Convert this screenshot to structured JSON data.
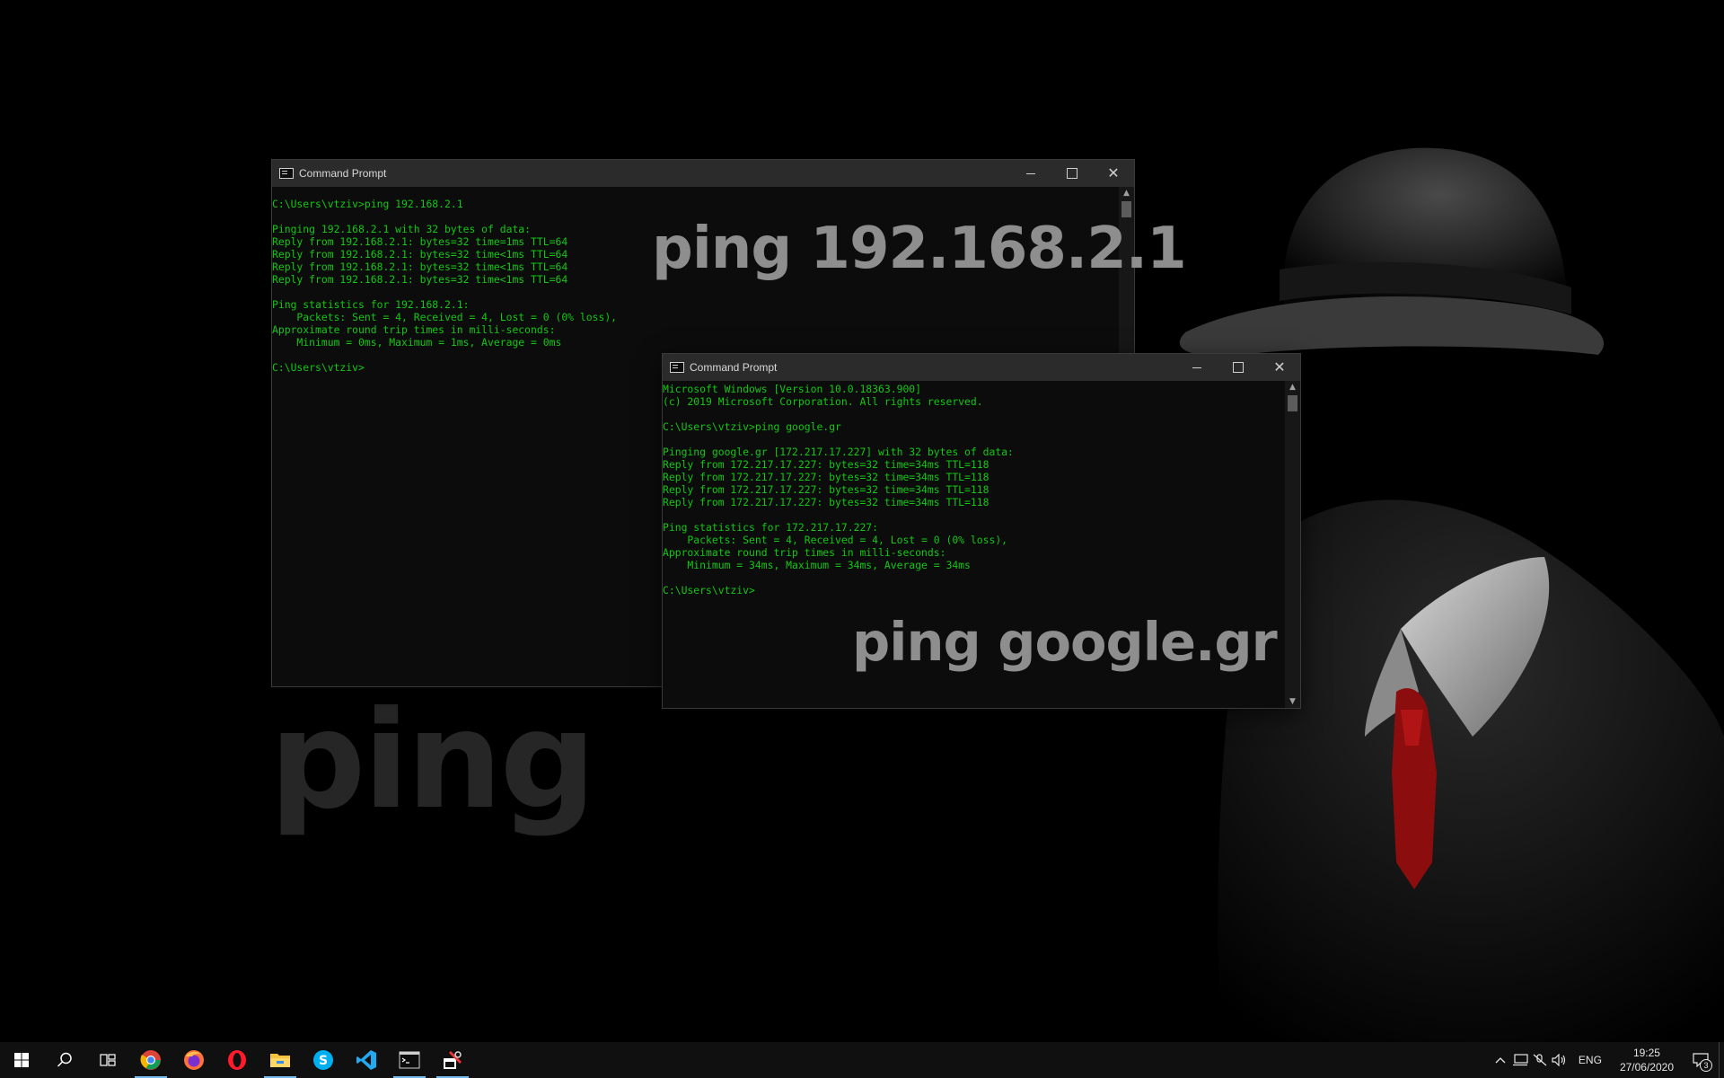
{
  "wallpaper": {
    "subject": "faceless-figure-with-fedora-and-red-tie"
  },
  "captions": {
    "ping_ip": "ping 192.168.2.1",
    "ping_google": "ping google.gr",
    "ping_big": "ping"
  },
  "window1": {
    "title": "Command Prompt",
    "lines": [
      "C:\\Users\\vtziv>ping 192.168.2.1",
      "",
      "Pinging 192.168.2.1 with 32 bytes of data:",
      "Reply from 192.168.2.1: bytes=32 time=1ms TTL=64",
      "Reply from 192.168.2.1: bytes=32 time<1ms TTL=64",
      "Reply from 192.168.2.1: bytes=32 time<1ms TTL=64",
      "Reply from 192.168.2.1: bytes=32 time<1ms TTL=64",
      "",
      "Ping statistics for 192.168.2.1:",
      "    Packets: Sent = 4, Received = 4, Lost = 0 (0% loss),",
      "Approximate round trip times in milli-seconds:",
      "    Minimum = 0ms, Maximum = 1ms, Average = 0ms",
      "",
      "C:\\Users\\vtziv>"
    ]
  },
  "window2": {
    "title": "Command Prompt",
    "lines": [
      "Microsoft Windows [Version 10.0.18363.900]",
      "(c) 2019 Microsoft Corporation. All rights reserved.",
      "",
      "C:\\Users\\vtziv>ping google.gr",
      "",
      "Pinging google.gr [172.217.17.227] with 32 bytes of data:",
      "Reply from 172.217.17.227: bytes=32 time=34ms TTL=118",
      "Reply from 172.217.17.227: bytes=32 time=34ms TTL=118",
      "Reply from 172.217.17.227: bytes=32 time=34ms TTL=118",
      "Reply from 172.217.17.227: bytes=32 time=34ms TTL=118",
      "",
      "Ping statistics for 172.217.17.227:",
      "    Packets: Sent = 4, Received = 4, Lost = 0 (0% loss),",
      "Approximate round trip times in milli-seconds:",
      "    Minimum = 34ms, Maximum = 34ms, Average = 34ms",
      "",
      "C:\\Users\\vtziv>"
    ]
  },
  "colors": {
    "console_text": "#13c713",
    "console_bg": "#0c0c0c",
    "titlebar_bg": "#2b2b2b",
    "taskbar_bg": "#101010",
    "active_indicator": "#76b9ed"
  },
  "taskbar": {
    "apps": [
      {
        "name": "start-icon"
      },
      {
        "name": "search-icon"
      },
      {
        "name": "task-view-icon"
      },
      {
        "name": "chrome-icon",
        "active": true
      },
      {
        "name": "firefox-icon",
        "active": false
      },
      {
        "name": "opera-icon",
        "active": false
      },
      {
        "name": "file-explorer-icon",
        "active": true
      },
      {
        "name": "skype-icon",
        "active": false
      },
      {
        "name": "vscode-icon",
        "active": false
      },
      {
        "name": "command-prompt-icon",
        "active": true
      },
      {
        "name": "snipping-tool-icon",
        "active": true
      }
    ],
    "tray": {
      "language": "ENG",
      "time": "19:25",
      "date": "27/06/2020",
      "notification_count": "3"
    }
  }
}
